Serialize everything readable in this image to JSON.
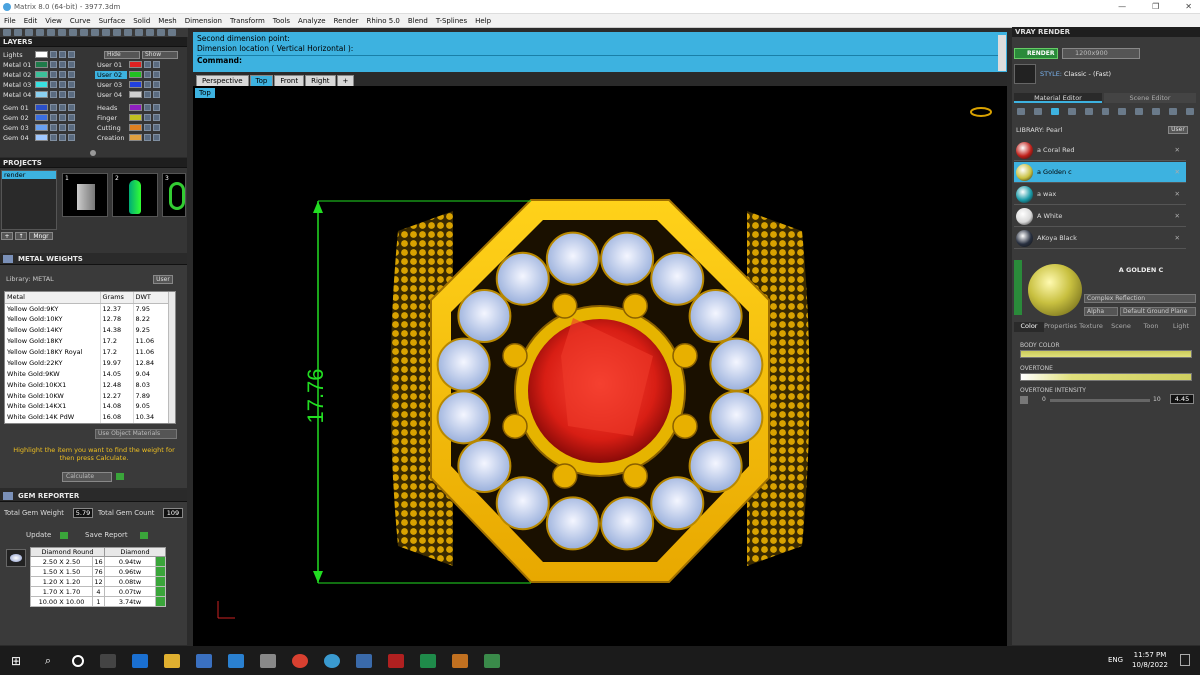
{
  "window": {
    "title": "Matrix 8.0 (64-bit) - 3977.3dm",
    "controls": [
      "—",
      "❐",
      "✕"
    ]
  },
  "menu": [
    "File",
    "Edit",
    "View",
    "Curve",
    "Surface",
    "Solid",
    "Mesh",
    "Dimension",
    "Transform",
    "Tools",
    "Analyze",
    "Render",
    "Rhino 5.0",
    "Blend",
    "T-Splines",
    "Help"
  ],
  "layers": {
    "title": "LAYERS",
    "left": [
      {
        "name": "Lights",
        "color": "#ffffff"
      },
      {
        "name": "Metal 01",
        "color": "#1f7a4a"
      },
      {
        "name": "Metal 02",
        "color": "#3cbf9a"
      },
      {
        "name": "Metal 03",
        "color": "#39e0e0"
      },
      {
        "name": "Metal 04",
        "color": "#8ad0f0"
      },
      {
        "name": "Gem 01",
        "color": "#2b50c8"
      },
      {
        "name": "Gem 02",
        "color": "#3b6fe0"
      },
      {
        "name": "Gem 03",
        "color": "#6aa0f0"
      },
      {
        "name": "Gem 04",
        "color": "#a0c8ff"
      }
    ],
    "right": [
      {
        "name": "Hide",
        "color": ""
      },
      {
        "name": "User 01",
        "color": "#e02020"
      },
      {
        "name": "User 02",
        "color": "#20c020"
      },
      {
        "name": "User 03",
        "color": "#2040e0"
      },
      {
        "name": "User 04",
        "color": "#d0d0d0"
      },
      {
        "name": "Heads",
        "color": "#9020c0"
      },
      {
        "name": "Finger",
        "color": "#c0c020"
      },
      {
        "name": "Cutting",
        "color": "#e08020"
      },
      {
        "name": "Creation",
        "color": "#e0a040"
      }
    ],
    "show_label": "Show"
  },
  "projects": {
    "title": "PROJECTS",
    "item": "render",
    "thumbs": [
      "1",
      "2",
      "3"
    ],
    "btn": "Mngr"
  },
  "metal_weights": {
    "title": "METAL WEIGHTS",
    "library_label": "Library: METAL",
    "lib_btn": "User",
    "columns": [
      "Metal",
      "Grams",
      "DWT"
    ],
    "rows": [
      [
        "Yellow Gold:9KY",
        "12.37",
        "7.95"
      ],
      [
        "Yellow Gold:10KY",
        "12.78",
        "8.22"
      ],
      [
        "Yellow Gold:14KY",
        "14.38",
        "9.25"
      ],
      [
        "Yellow Gold:18KY",
        "17.2",
        "11.06"
      ],
      [
        "Yellow Gold:18KY Royal",
        "17.2",
        "11.06"
      ],
      [
        "Yellow Gold:22KY",
        "19.97",
        "12.84"
      ],
      [
        "White Gold:9KW",
        "14.05",
        "9.04"
      ],
      [
        "White Gold:10KX1",
        "12.48",
        "8.03"
      ],
      [
        "White Gold:10KW",
        "12.27",
        "7.89"
      ],
      [
        "White Gold:14KX1",
        "14.08",
        "9.05"
      ],
      [
        "White Gold:14K PdW",
        "16.08",
        "10.34"
      ]
    ],
    "use_obj": "Use Object Materials",
    "hint": "Highlight the item you want to find the weight for then press Calculate.",
    "calc": "Calculate"
  },
  "gem_reporter": {
    "title": "GEM REPORTER",
    "total_weight_label": "Total Gem Weight",
    "total_weight": "5.79",
    "total_count_label": "Total Gem Count",
    "total_count": "109",
    "update": "Update",
    "save": "Save Report",
    "columns": [
      "Diamond Round",
      "Diamond"
    ],
    "rows": [
      [
        "2.50 X 2.50",
        "16",
        "0.94tw"
      ],
      [
        "1.50 X 1.50",
        "76",
        "0.96tw"
      ],
      [
        "1.20 X 1.20",
        "12",
        "0.08tw"
      ],
      [
        "1.70 X 1.70",
        "4",
        "0.07tw"
      ],
      [
        "10.00 X 10.00",
        "1",
        "3.74tw"
      ]
    ]
  },
  "command": {
    "line1": "Second dimension point:",
    "line2": "Dimension location ( Vertical  Horizontal ):",
    "prompt": "Command:"
  },
  "viewtabs": [
    "Perspective",
    "Top",
    "Front",
    "Right"
  ],
  "viewport": {
    "label": "Top",
    "dimension": "17.76"
  },
  "vray": {
    "title": "VRAY RENDER",
    "render_btn": "RENDER",
    "resolution": "1200x900",
    "style_label": "STYLE:",
    "style_value": "Classic - (Fast)",
    "tab_material": "Material Editor",
    "tab_scene": "Scene Editor",
    "library": "LIBRARY: Pearl",
    "lib_user": "User",
    "materials": [
      {
        "name": "a Coral Red",
        "color": "#c0201a"
      },
      {
        "name": "a Golden c",
        "color": "#c8c040"
      },
      {
        "name": "a wax",
        "color": "#1a9aa8"
      },
      {
        "name": "A White",
        "color": "#d8d8d8"
      },
      {
        "name": "AKoya Black",
        "color": "#283040"
      }
    ],
    "selected": "A GOLDEN C",
    "mat_type": "Complex Reflection",
    "alpha": "Alpha",
    "ground": "Default Ground Plane",
    "subtabs": [
      "Color",
      "Properties",
      "Texture",
      "Scene",
      "Toon",
      "Light"
    ],
    "body_color": "BODY COLOR",
    "overtone": "OVERTONE",
    "overtone_intensity": "OVERTONE INTENSITY",
    "slider_min": "0",
    "slider_max": "10",
    "slider_value": "4.45"
  },
  "taskbar": {
    "lang": "ENG",
    "time": "11:57 PM",
    "date": "10/8/2022"
  }
}
